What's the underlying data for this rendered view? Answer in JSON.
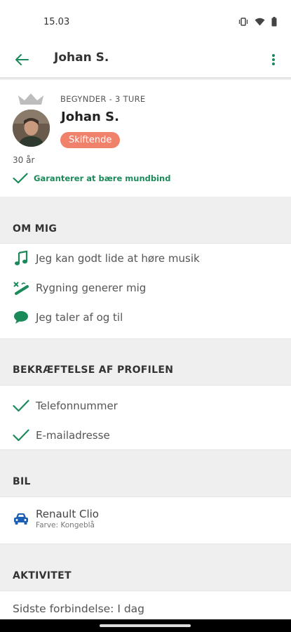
{
  "status_bar": {
    "time": "15.03",
    "icons": [
      "vibrate-icon",
      "wifi-icon",
      "battery-icon"
    ]
  },
  "app_bar": {
    "title": "Johan S.",
    "back_icon": "arrow-left-icon",
    "more_icon": "more-vert-icon"
  },
  "profile": {
    "level": "BEGYNDER - 3 TURE",
    "name": "Johan S.",
    "badge": "Skiftende",
    "age": "30 år",
    "guarantee": "Garanterer at bære mundbind"
  },
  "about": {
    "title": "OM MIG",
    "items": [
      {
        "icon": "music-note-icon",
        "label": "Jeg kan godt lide at høre musik"
      },
      {
        "icon": "smoking-icon",
        "label": "Rygning generer mig"
      },
      {
        "icon": "chat-bubble-icon",
        "label": "Jeg taler af og til"
      }
    ]
  },
  "verification": {
    "title": "BEKRÆFTELSE AF PROFILEN",
    "items": [
      {
        "icon": "check-icon",
        "label": "Telefonnummer"
      },
      {
        "icon": "check-icon",
        "label": "E-mailadresse"
      }
    ]
  },
  "car": {
    "title": "BIL",
    "name": "Renault Clio",
    "color": "Farve: Kongeblå"
  },
  "activity": {
    "title": "AKTIVITET",
    "last_connection": "Sidste forbindelse: I dag"
  },
  "colors": {
    "accent_green": "#1b8a5a",
    "badge": "#f0826c",
    "car_blue": "#1a5fb4"
  }
}
